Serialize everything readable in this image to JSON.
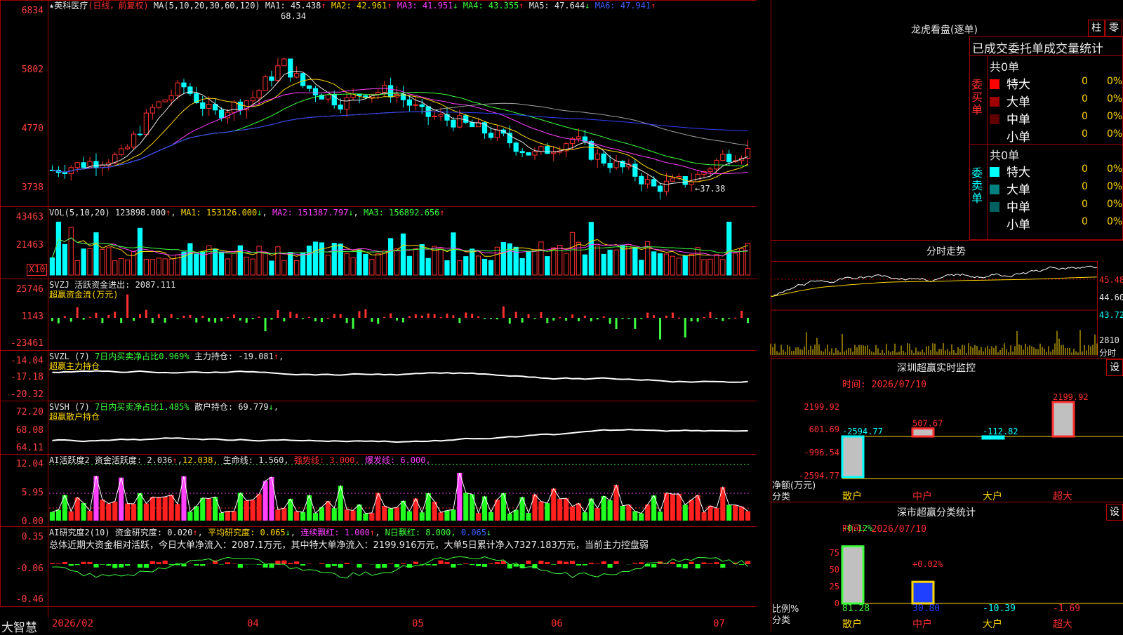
{
  "app": {
    "brand": "大智慧"
  },
  "main": {
    "title": "★英科医疗",
    "mode": "(日线，前复权)",
    "ma_label": "MA(5,10,20,30,60,120)",
    "ma": [
      {
        "k": "MA1:",
        "v": "45.438",
        "a": "↑"
      },
      {
        "k": "MA2:",
        "v": "42.961",
        "a": "↑"
      },
      {
        "k": "MA3:",
        "v": "41.951",
        "a": "↓"
      },
      {
        "k": "MA4:",
        "v": "43.355",
        "a": "↑"
      },
      {
        "k": "MA5:",
        "v": "47.644",
        "a": "↓"
      },
      {
        "k": "MA6:",
        "v": "47.941",
        "a": "↑"
      }
    ],
    "y_labels": [
      "6834",
      "5802",
      "4770",
      "3738"
    ],
    "hi_note": "68.34",
    "lo_note": "←37.38"
  },
  "vol": {
    "label": "VOL(5,10,20)",
    "v": "123898.000",
    "ma1": "MA1: 153126.000",
    "ma2": "MA2: 151387.797",
    "ma3": "MA3: 156892.656",
    "y_labels": [
      "43463",
      "21463"
    ],
    "unit": "X10"
  },
  "svzj": {
    "label": "SVZJ  活跃资金进出: 2087.111",
    "sub": "超赢资金流(万元)",
    "y_labels": [
      "25746",
      "1143",
      "-23461"
    ]
  },
  "svzl": {
    "label": "SVZL (7)",
    "p1": "7日内买卖净占比0.969%",
    "p2": "主力持仓: -19.081",
    "sub": "超赢主力持仓",
    "y_labels": [
      "-14.04",
      "-17.18",
      "-20.32"
    ]
  },
  "svsh": {
    "label": "SVSH (7)",
    "p1": "7日内买卖净占比1.485%",
    "p2": "散户持仓: 69.779",
    "sub": "超赢散户持仓",
    "y_labels": [
      "72.20",
      "68.08",
      "64.11"
    ]
  },
  "ai1": {
    "label": "AI活跃度2",
    "p1": "资金活跃度: 2.036",
    "p2": "12.038,",
    "p3": "生命线: 1.560,",
    "p4": "强势线: 3.000,",
    "p5": "爆发线: 6.000,",
    "y_labels": [
      "12.04",
      "5.95",
      "0.00"
    ]
  },
  "ai2": {
    "label": "AI研究度2(10)",
    "p1": "资金研究度: 0.020",
    "p2": "平均研究度: 0.065",
    "p3": "连续飘红: 1.000",
    "p4": "N日飘红: 8.000,",
    "p5": "0.065",
    "summary": "总体近期大资金相对活跃，今日大单净流入：2087.1万元，其中特大单净流入：2199.916万元，大单5日累计净入7327.183万元，当前主力控盘弱",
    "y_labels": [
      "0.35",
      "-0.06",
      "-0.46"
    ]
  },
  "xaxis": [
    "2026/02",
    "04",
    "05",
    "06",
    "07"
  ],
  "longhu": {
    "title": "龙虎看盘(逐单)",
    "btn1": "柱",
    "btn2": "零",
    "tabs": "已成交委托单成交量统计",
    "buy": {
      "side": "委买单",
      "total": "共0单",
      "rows": [
        {
          "n": "特大",
          "v": "0",
          "p": "0%",
          "c": "#ff0000"
        },
        {
          "n": "大单",
          "v": "0",
          "p": "0%",
          "c": "#a00000"
        },
        {
          "n": "中单",
          "v": "0",
          "p": "0%",
          "c": "#600000"
        },
        {
          "n": "小单",
          "v": "0",
          "p": "0%",
          "c": ""
        }
      ]
    },
    "sell": {
      "side": "委卖单",
      "total": "共0单",
      "rows": [
        {
          "n": "特大",
          "v": "0",
          "p": "0%",
          "c": "#00ffff"
        },
        {
          "n": "大单",
          "v": "0",
          "p": "0%",
          "c": "#008080"
        },
        {
          "n": "中单",
          "v": "0",
          "p": "0%",
          "c": "#006060"
        },
        {
          "n": "小单",
          "v": "0",
          "p": "0%",
          "c": ""
        }
      ]
    }
  },
  "intraday": {
    "title": "分时走势",
    "y_labels": [
      "45.48",
      "44.60",
      "43.72"
    ],
    "vol_labels": [
      "2810",
      "分时"
    ]
  },
  "sz_monitor": {
    "title": "深圳超赢实时监控",
    "btn": "设",
    "time": "时间: 2026/07/10",
    "y_labels": [
      "2199.92",
      "601.69",
      "-996.54",
      "-2594.77"
    ],
    "unit": "净额(万元)",
    "cat": "分类",
    "bars": [
      {
        "name": "散户",
        "value": "-2594.77"
      },
      {
        "name": "中户",
        "value": "507.67"
      },
      {
        "name": "大户",
        "value": "-112.82"
      },
      {
        "name": "超大",
        "value": "2199.92"
      }
    ]
  },
  "sz_class": {
    "title": "深市超赢分类统计",
    "btn": "设",
    "time": "时间: 2026/07/10",
    "y_labels": [
      "75",
      "50",
      "25",
      "0"
    ],
    "unit": "比例%",
    "cat": "分类",
    "top_labels": [
      "-0.12%",
      "+0.02%"
    ],
    "values": [
      "81.28",
      "30.80",
      "-10.39",
      "-1.69"
    ],
    "names": [
      "散户",
      "中户",
      "大户",
      "超大"
    ]
  },
  "chart_data": [
    {
      "type": "candlestick",
      "title": "英科医疗 日线",
      "ylim": [
        37.38,
        68.34
      ],
      "annot": {
        "high": 68.34,
        "low": 37.38
      },
      "x_ticks": [
        "2026/02",
        "04",
        "05",
        "06",
        "07"
      ],
      "series": [
        {
          "name": "MA1",
          "last": 45.438
        },
        {
          "name": "MA2",
          "last": 42.961
        },
        {
          "name": "MA3",
          "last": 41.951
        },
        {
          "name": "MA4",
          "last": 43.355
        },
        {
          "name": "MA5",
          "last": 47.644
        },
        {
          "name": "MA6",
          "last": 47.941
        }
      ]
    },
    {
      "type": "bar",
      "title": "VOL(5,10,20)",
      "last": 123898.0,
      "ma": [
        153126.0,
        151387.797,
        156892.656
      ]
    },
    {
      "type": "bar",
      "title": "深圳超赢实时监控",
      "categories": [
        "散户",
        "中户",
        "大户",
        "超大"
      ],
      "values": [
        -2594.77,
        507.67,
        -112.82,
        2199.92
      ],
      "ylabel": "净额(万元)"
    },
    {
      "type": "bar",
      "title": "深市超赢分类统计",
      "categories": [
        "散户",
        "中户",
        "大户",
        "超大"
      ],
      "values": [
        81.28,
        30.8,
        -10.39,
        -1.69
      ],
      "ylabel": "比例%"
    }
  ]
}
